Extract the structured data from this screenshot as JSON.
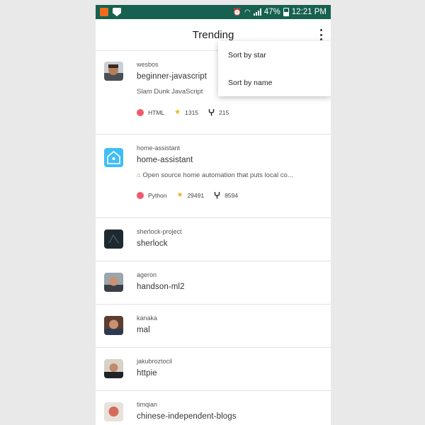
{
  "status_bar": {
    "battery": "47%",
    "time": "12:21 PM",
    "icons": [
      "app-orange-icon",
      "shield-icon",
      "alarm-icon",
      "wifi-icon",
      "signal-icon",
      "battery-icon"
    ]
  },
  "app_bar": {
    "title": "Trending",
    "overflow_icon": "more-vert-icon"
  },
  "menu": {
    "items": [
      {
        "label": "Sort by star"
      },
      {
        "label": "Sort by name"
      }
    ]
  },
  "repos": [
    {
      "owner": "wesbos",
      "name": "beginner-javascript",
      "description": "Slam Dunk JavaScript",
      "language": "HTML",
      "language_color": "#ef5b6b",
      "stars": "1315",
      "forks": "215"
    },
    {
      "owner": "home-assistant",
      "name": "home-assistant",
      "description": "Open source home automation that puts local co...",
      "language": "Python",
      "language_color": "#ef5b6b",
      "stars": "29491",
      "forks": "8594"
    },
    {
      "owner": "sherlock-project",
      "name": "sherlock"
    },
    {
      "owner": "ageron",
      "name": "handson-ml2"
    },
    {
      "owner": "kanaka",
      "name": "mal"
    },
    {
      "owner": "jakubroztocil",
      "name": "httpie"
    },
    {
      "owner": "timqian",
      "name": "chinese-independent-blogs"
    }
  ],
  "colors": {
    "status_bar": "#16614f",
    "star": "#e9b21a",
    "language_dot": "#ef5b6b"
  }
}
